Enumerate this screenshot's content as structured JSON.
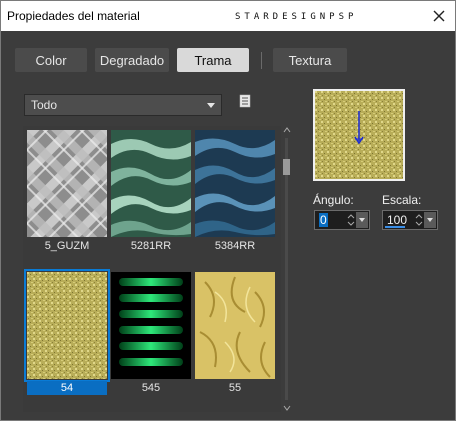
{
  "window": {
    "title": "Propiedades del material",
    "watermark": "STARDESIGNPSP"
  },
  "tabs": [
    {
      "label": "Color",
      "active": false
    },
    {
      "label": "Degradado",
      "active": false
    },
    {
      "label": "Trama",
      "active": true
    },
    {
      "label": "Textura",
      "active": false
    }
  ],
  "category_select": {
    "value": "Todo"
  },
  "patterns": [
    {
      "label": "5_GUZM",
      "selected": false
    },
    {
      "label": "5281RR",
      "selected": false
    },
    {
      "label": "5384RR",
      "selected": false
    },
    {
      "label": "54",
      "selected": true
    },
    {
      "label": "545",
      "selected": false
    },
    {
      "label": "55",
      "selected": false
    }
  ],
  "angle": {
    "label": "Ángulo:",
    "value": "0"
  },
  "scale": {
    "label": "Escala:",
    "value": "100"
  },
  "colors": {
    "accent": "#0a6ec2",
    "background": "#3c3c3c",
    "active_tab": "#d9d9d9"
  },
  "icons": [
    "close-icon",
    "pattern-list-icon",
    "chevron-down-icon",
    "spin-up-icon",
    "spin-down-icon"
  ]
}
